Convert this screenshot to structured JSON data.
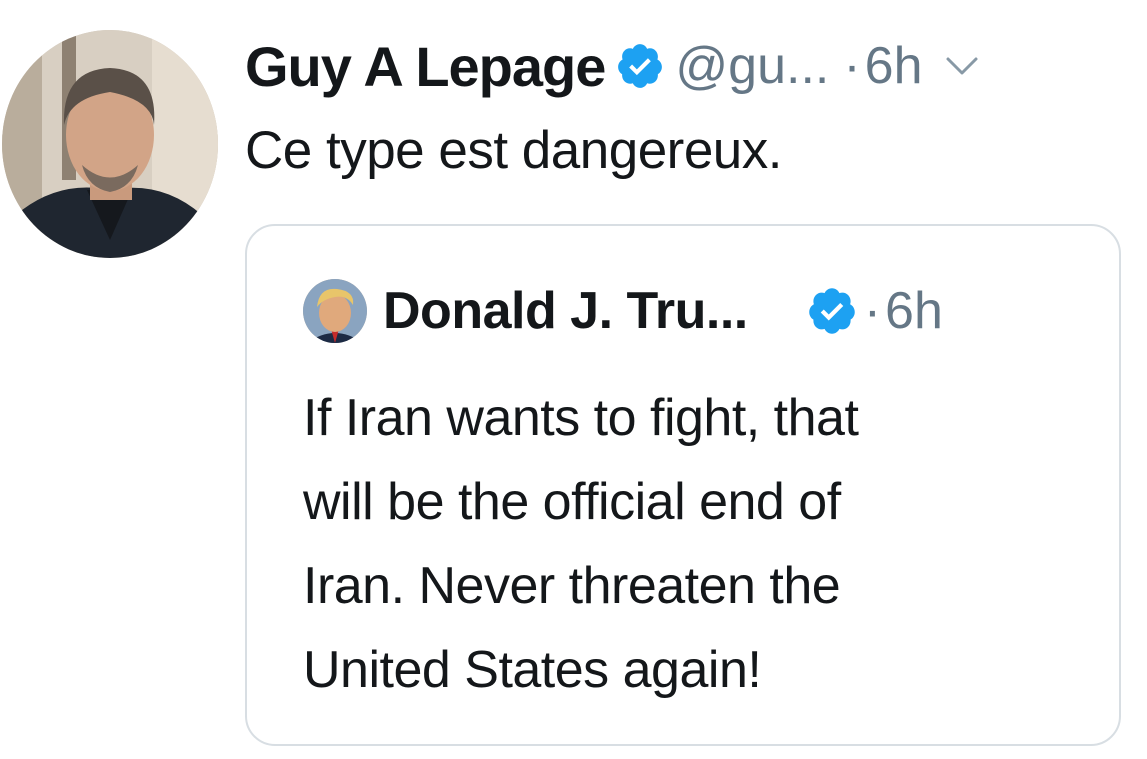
{
  "tweet": {
    "author": {
      "display_name": "Guy A Lepage",
      "handle": "@gu...",
      "verified": true
    },
    "separator": "·",
    "time": "6h",
    "text": "Ce type est dangereux.",
    "icons": {
      "avatar": "profile-photo",
      "verified": "verified-badge-icon",
      "menu": "chevron-down-icon"
    }
  },
  "quoted_tweet": {
    "author": {
      "display_name": "Donald J. Tru...",
      "verified": true
    },
    "separator": "·",
    "time": "6h",
    "text_lines": [
      "If Iran wants to fight, that",
      "will be the official end of",
      "Iran. Never threaten the",
      "United States again!"
    ]
  },
  "colors": {
    "verified_blue": "#1da1f2",
    "text_primary": "#14171a",
    "text_secondary": "#657786",
    "border": "#d8dee3"
  }
}
